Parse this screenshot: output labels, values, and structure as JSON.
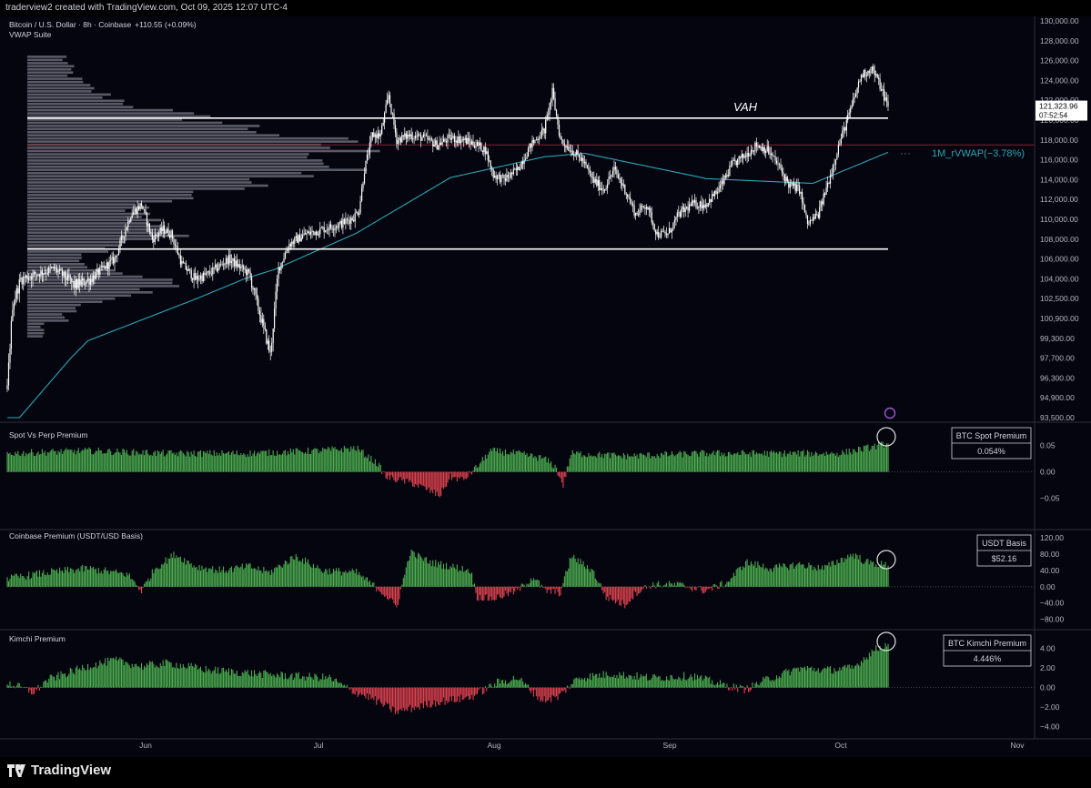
{
  "header": {
    "text": "traderview2 created with TradingView.com, Oct 09, 2025 12:07 UTC-4"
  },
  "footer": {
    "brand": "TradingView"
  },
  "colors": {
    "bg": "#050510",
    "up": "#4caf50",
    "down": "#e0424f",
    "vwap": "#2aa6b3",
    "candle": "#ffffff",
    "level": "#ffffff",
    "poc": "#8b1d2c"
  },
  "chart_data": [
    {
      "type": "candlestick",
      "title": "Bitcoin / U.S. Dollar · 8h · Coinbase",
      "change": "+110.55 (+0.09%)",
      "subtitle": "VWAP Suite",
      "price_axis_ticks": [
        "130,000.00",
        "128,000.00",
        "126,000.00",
        "124,000.00",
        "122,000.00",
        "120,000.00",
        "118,000.00",
        "116,000.00",
        "114,000.00",
        "112,000.00",
        "110,000.00",
        "108,000.00",
        "106,000.00",
        "104,000.00",
        "102,500.00",
        "100,900.00",
        "99,300.00",
        "97,700.00",
        "96,300.00",
        "94,900.00",
        "93,500.00"
      ],
      "last_price": "121,323.96",
      "countdown": "07:52:54",
      "vah_label": "VAH",
      "vah": 120200,
      "val": 107000,
      "poc": 117500,
      "vwap_label": "1M_rVWAP(−3.78%)",
      "time_axis": [
        "Jun",
        "Jul",
        "Aug",
        "Sep",
        "Oct",
        "Nov"
      ],
      "price_anchors": [
        [
          0,
          95500
        ],
        [
          4,
          102000
        ],
        [
          10,
          104000
        ],
        [
          22,
          104500
        ],
        [
          35,
          105000
        ],
        [
          50,
          103500
        ],
        [
          62,
          104000
        ],
        [
          80,
          106000
        ],
        [
          92,
          110500
        ],
        [
          100,
          111500
        ],
        [
          108,
          108000
        ],
        [
          116,
          109000
        ],
        [
          122,
          108500
        ],
        [
          130,
          105500
        ],
        [
          140,
          104000
        ],
        [
          150,
          104500
        ],
        [
          165,
          106000
        ],
        [
          180,
          104500
        ],
        [
          190,
          100500
        ],
        [
          196,
          98000
        ],
        [
          202,
          105000
        ],
        [
          210,
          107500
        ],
        [
          222,
          108500
        ],
        [
          235,
          109000
        ],
        [
          248,
          109500
        ],
        [
          258,
          110200
        ],
        [
          262,
          111000
        ],
        [
          266,
          115000
        ],
        [
          272,
          118500
        ],
        [
          278,
          118500
        ],
        [
          284,
          122500
        ],
        [
          290,
          118000
        ],
        [
          300,
          118500
        ],
        [
          310,
          118200
        ],
        [
          320,
          117500
        ],
        [
          330,
          118200
        ],
        [
          340,
          118000
        ],
        [
          350,
          117500
        ],
        [
          356,
          117000
        ],
        [
          362,
          114500
        ],
        [
          370,
          114000
        ],
        [
          380,
          115000
        ],
        [
          390,
          117500
        ],
        [
          400,
          119000
        ],
        [
          406,
          122800
        ],
        [
          412,
          118000
        ],
        [
          420,
          117000
        ],
        [
          428,
          116000
        ],
        [
          436,
          114000
        ],
        [
          444,
          113000
        ],
        [
          452,
          115000
        ],
        [
          460,
          113000
        ],
        [
          468,
          110500
        ],
        [
          476,
          111500
        ],
        [
          484,
          108500
        ],
        [
          492,
          108500
        ],
        [
          500,
          110500
        ],
        [
          510,
          111500
        ],
        [
          520,
          111500
        ],
        [
          530,
          113000
        ],
        [
          540,
          115500
        ],
        [
          550,
          116500
        ],
        [
          558,
          117500
        ],
        [
          566,
          117000
        ],
        [
          574,
          115500
        ],
        [
          582,
          113500
        ],
        [
          590,
          113000
        ],
        [
          596,
          109500
        ],
        [
          604,
          110500
        ],
        [
          612,
          114000
        ],
        [
          620,
          117800
        ],
        [
          628,
          121000
        ],
        [
          636,
          124500
        ],
        [
          644,
          125200
        ],
        [
          650,
          123500
        ],
        [
          656,
          121323
        ]
      ]
    },
    {
      "type": "bar",
      "title": "Spot Vs Perp Premium",
      "box_label": "BTC Spot Premium",
      "box_value": "0.054%",
      "y_ticks": [
        "0.05",
        "0.00",
        "−0.05"
      ],
      "ylim": [
        -0.08,
        0.07
      ],
      "anchors": [
        [
          0,
          0.035
        ],
        [
          60,
          0.04
        ],
        [
          120,
          0.035
        ],
        [
          180,
          0.035
        ],
        [
          230,
          0.04
        ],
        [
          260,
          0.045
        ],
        [
          276,
          0.015
        ],
        [
          282,
          -0.01
        ],
        [
          300,
          -0.02
        ],
        [
          310,
          -0.03
        ],
        [
          322,
          -0.045
        ],
        [
          330,
          -0.01
        ],
        [
          340,
          -0.015
        ],
        [
          350,
          0.01
        ],
        [
          360,
          0.04
        ],
        [
          380,
          0.035
        ],
        [
          400,
          0.025
        ],
        [
          408,
          0.01
        ],
        [
          414,
          -0.025
        ],
        [
          420,
          0.035
        ],
        [
          460,
          0.03
        ],
        [
          520,
          0.035
        ],
        [
          580,
          0.035
        ],
        [
          620,
          0.035
        ],
        [
          640,
          0.045
        ],
        [
          656,
          0.054
        ]
      ]
    },
    {
      "type": "bar",
      "title": "Coinbase Premium (USDT/USD Basis)",
      "box_label": "USDT Basis",
      "box_value": "$52.16",
      "y_ticks": [
        "120.00",
        "80.00",
        "40.00",
        "0.00",
        "−40.00",
        "−80.00"
      ],
      "ylim": [
        -90,
        125
      ],
      "anchors": [
        [
          0,
          20
        ],
        [
          30,
          35
        ],
        [
          60,
          45
        ],
        [
          90,
          30
        ],
        [
          100,
          -10
        ],
        [
          110,
          45
        ],
        [
          125,
          80
        ],
        [
          140,
          50
        ],
        [
          160,
          40
        ],
        [
          180,
          50
        ],
        [
          195,
          35
        ],
        [
          215,
          75
        ],
        [
          235,
          40
        ],
        [
          260,
          35
        ],
        [
          280,
          -15
        ],
        [
          290,
          -50
        ],
        [
          300,
          85
        ],
        [
          315,
          60
        ],
        [
          330,
          50
        ],
        [
          345,
          40
        ],
        [
          350,
          -25
        ],
        [
          362,
          -30
        ],
        [
          370,
          -20
        ],
        [
          380,
          -10
        ],
        [
          392,
          25
        ],
        [
          400,
          -10
        ],
        [
          412,
          -15
        ],
        [
          420,
          75
        ],
        [
          436,
          40
        ],
        [
          446,
          -25
        ],
        [
          460,
          -45
        ],
        [
          468,
          -15
        ],
        [
          480,
          5
        ],
        [
          500,
          5
        ],
        [
          520,
          -10
        ],
        [
          536,
          10
        ],
        [
          550,
          60
        ],
        [
          570,
          45
        ],
        [
          590,
          55
        ],
        [
          608,
          45
        ],
        [
          620,
          65
        ],
        [
          630,
          80
        ],
        [
          640,
          60
        ],
        [
          656,
          52
        ]
      ]
    },
    {
      "type": "bar",
      "title": "Kimchi Premium",
      "box_label": "BTC Kimchi Premium",
      "box_value": "4.446%",
      "y_ticks": [
        "4.00",
        "2.00",
        "0.00",
        "−2.00",
        "−4.00"
      ],
      "ylim": [
        -4.6,
        5.0
      ],
      "anchors": [
        [
          0,
          0.5
        ],
        [
          20,
          -0.5
        ],
        [
          30,
          0.8
        ],
        [
          60,
          2.2
        ],
        [
          80,
          2.8
        ],
        [
          100,
          2.2
        ],
        [
          120,
          2.5
        ],
        [
          150,
          1.8
        ],
        [
          180,
          1.5
        ],
        [
          210,
          1.2
        ],
        [
          240,
          1.0
        ],
        [
          256,
          -0.3
        ],
        [
          270,
          -1.0
        ],
        [
          290,
          -2.5
        ],
        [
          305,
          -2.0
        ],
        [
          320,
          -1.5
        ],
        [
          345,
          -1.0
        ],
        [
          365,
          0.5
        ],
        [
          380,
          1.0
        ],
        [
          392,
          -0.5
        ],
        [
          398,
          -1.3
        ],
        [
          410,
          -1.0
        ],
        [
          425,
          1.0
        ],
        [
          450,
          1.4
        ],
        [
          480,
          1.0
        ],
        [
          510,
          1.2
        ],
        [
          535,
          0.2
        ],
        [
          550,
          -0.2
        ],
        [
          565,
          0.8
        ],
        [
          590,
          2.0
        ],
        [
          610,
          1.8
        ],
        [
          630,
          2.0
        ],
        [
          645,
          3.8
        ],
        [
          656,
          4.446
        ]
      ]
    }
  ]
}
